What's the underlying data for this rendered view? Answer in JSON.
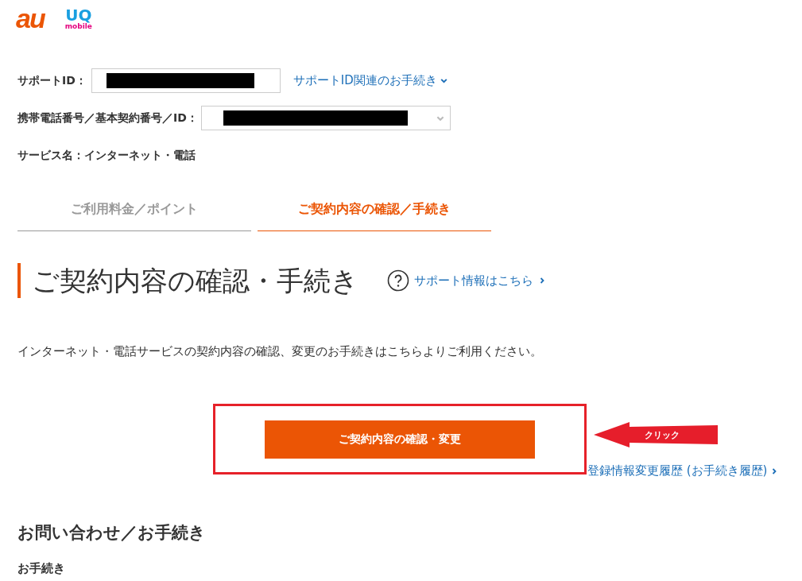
{
  "brand": {
    "au_logo": "au",
    "uq_logo": "UQ",
    "uq_subtitle": "mobile"
  },
  "account": {
    "support_id": {
      "label": "サポートID：",
      "redacted": true,
      "link": "サポートID関連のお手続き"
    },
    "number": {
      "label": "携帯電話番号／基本契約番号／ID：",
      "redacted": true
    },
    "service": "サービス名：インターネット・電話"
  },
  "tabs": [
    {
      "label": "ご利用料金／ポイント",
      "selected": false
    },
    {
      "label": "ご契約内容の確認／手続き",
      "selected": true
    }
  ],
  "page_title": "ご契約内容の確認・手続き",
  "help_link": "サポート情報はこちら",
  "description": "インターネット・電話サービスの契約内容の確認、変更のお手続きはこちらよりご利用ください。",
  "primary_button": "ご契約内容の確認・変更",
  "annotation": {
    "label": "クリック"
  },
  "history_link": "登録情報変更履歴 (お手続き履歴)",
  "section_title": "お問い合わせ／お手続き",
  "subsection_title": "お手続き"
}
